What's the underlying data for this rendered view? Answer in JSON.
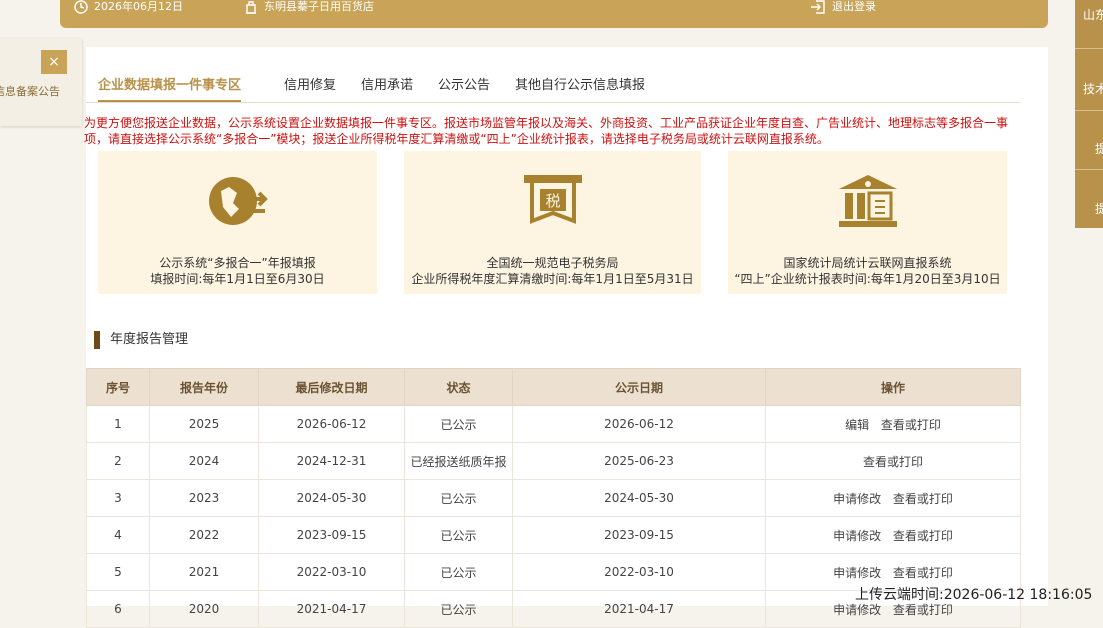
{
  "topbar": {
    "date": "2026年06月12日",
    "shop": "东明县蓁子日用百货店",
    "logout": "退出登录"
  },
  "right_side": {
    "items": [
      "山东",
      "技术",
      "提",
      "提"
    ]
  },
  "left_notice": {
    "close": "×",
    "text": "信息备案公告"
  },
  "tabs": [
    {
      "label": "企业数据填报一件事专区",
      "active": true
    },
    {
      "label": "信用修复"
    },
    {
      "label": "信用承诺"
    },
    {
      "label": "公示公告"
    },
    {
      "label": "其他自行公示信息填报"
    }
  ],
  "notice": "为更方便您报送企业数据，公示系统设置企业数据填报一件事专区。报送市场监管年报以及海关、外商投资、工业产品获证企业年度自查、广告业统计、地理标志等多报合一事项，请直接选择公示系统“多报合一”模块；报送企业所得税年度汇算清缴或“四上”企业统计报表，请选择电子税务局或统计云联网直报系统。",
  "cards": [
    {
      "icon": "multi-report-icon",
      "line1": "公示系统“多报合一”年报填报",
      "line2": "填报时间:每年1月1日至6月30日"
    },
    {
      "icon": "tax-icon",
      "line1": "全国统一规范电子税务局",
      "line2": "企业所得税年度汇算清缴时间:每年1月1日至5月31日"
    },
    {
      "icon": "statistics-bureau-icon",
      "line1": "国家统计局统计云联网直报系统",
      "line2": "“四上”企业统计报表时间:每年1月20日至3月10日"
    }
  ],
  "section_title": "年度报告管理",
  "table": {
    "headers": [
      "序号",
      "报告年份",
      "最后修改日期",
      "状态",
      "公示日期",
      "操作"
    ],
    "rows": [
      {
        "no": "1",
        "year": "2025",
        "modified": "2026-06-12",
        "status": "已公示",
        "published": "2026-06-12",
        "ops": [
          "编辑",
          "查看或打印"
        ]
      },
      {
        "no": "2",
        "year": "2024",
        "modified": "2024-12-31",
        "status": "已经报送纸质年报",
        "published": "2025-06-23",
        "ops": [
          "查看或打印"
        ]
      },
      {
        "no": "3",
        "year": "2023",
        "modified": "2024-05-30",
        "status": "已公示",
        "published": "2024-05-30",
        "ops": [
          "申请修改",
          "查看或打印"
        ]
      },
      {
        "no": "4",
        "year": "2022",
        "modified": "2023-09-15",
        "status": "已公示",
        "published": "2023-09-15",
        "ops": [
          "申请修改",
          "查看或打印"
        ]
      },
      {
        "no": "5",
        "year": "2021",
        "modified": "2022-03-10",
        "status": "已公示",
        "published": "2022-03-10",
        "ops": [
          "申请修改",
          "查看或打印"
        ]
      },
      {
        "no": "6",
        "year": "2020",
        "modified": "2021-04-17",
        "status": "已公示",
        "published": "2021-04-17",
        "ops": [
          "申请修改",
          "查看或打印"
        ]
      }
    ]
  },
  "upload_time": "上传云端时间:2026-06-12 18:16:05",
  "colors": {
    "accent": "#c9a458",
    "dark_accent": "#b8924a",
    "notice_red": "#cc1111",
    "card_bg": "#fdf4e1"
  }
}
